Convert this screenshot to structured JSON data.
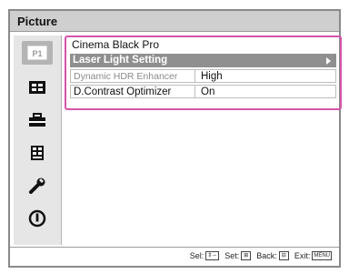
{
  "window": {
    "title": "Picture"
  },
  "sidebar": {
    "items": [
      {
        "icon": "picture-icon",
        "active": true
      },
      {
        "icon": "screen-icon",
        "active": false
      },
      {
        "icon": "setup-icon",
        "active": false
      },
      {
        "icon": "function-icon",
        "active": false
      },
      {
        "icon": "installation-icon",
        "active": false
      },
      {
        "icon": "information-icon",
        "active": false
      }
    ]
  },
  "menu": {
    "title": "Cinema Black Pro",
    "rows": [
      {
        "label": "Laser Light Setting",
        "value": "",
        "selected": true
      },
      {
        "label": "Dynamic HDR Enhancer",
        "value": "High"
      },
      {
        "label": "D.Contrast Optimizer",
        "value": "On"
      }
    ]
  },
  "footer": {
    "hints": [
      {
        "label": "Sel:",
        "key": "⇕⇔"
      },
      {
        "label": "Set:",
        "key": "⊞"
      },
      {
        "label": "Back:",
        "key": "⊟"
      },
      {
        "label": "Exit:",
        "key": "MENU"
      }
    ]
  },
  "colors": {
    "highlight_border": "#d454a8",
    "selected_row": "#8f8f8f",
    "title_bar": "#cfcfcf"
  }
}
